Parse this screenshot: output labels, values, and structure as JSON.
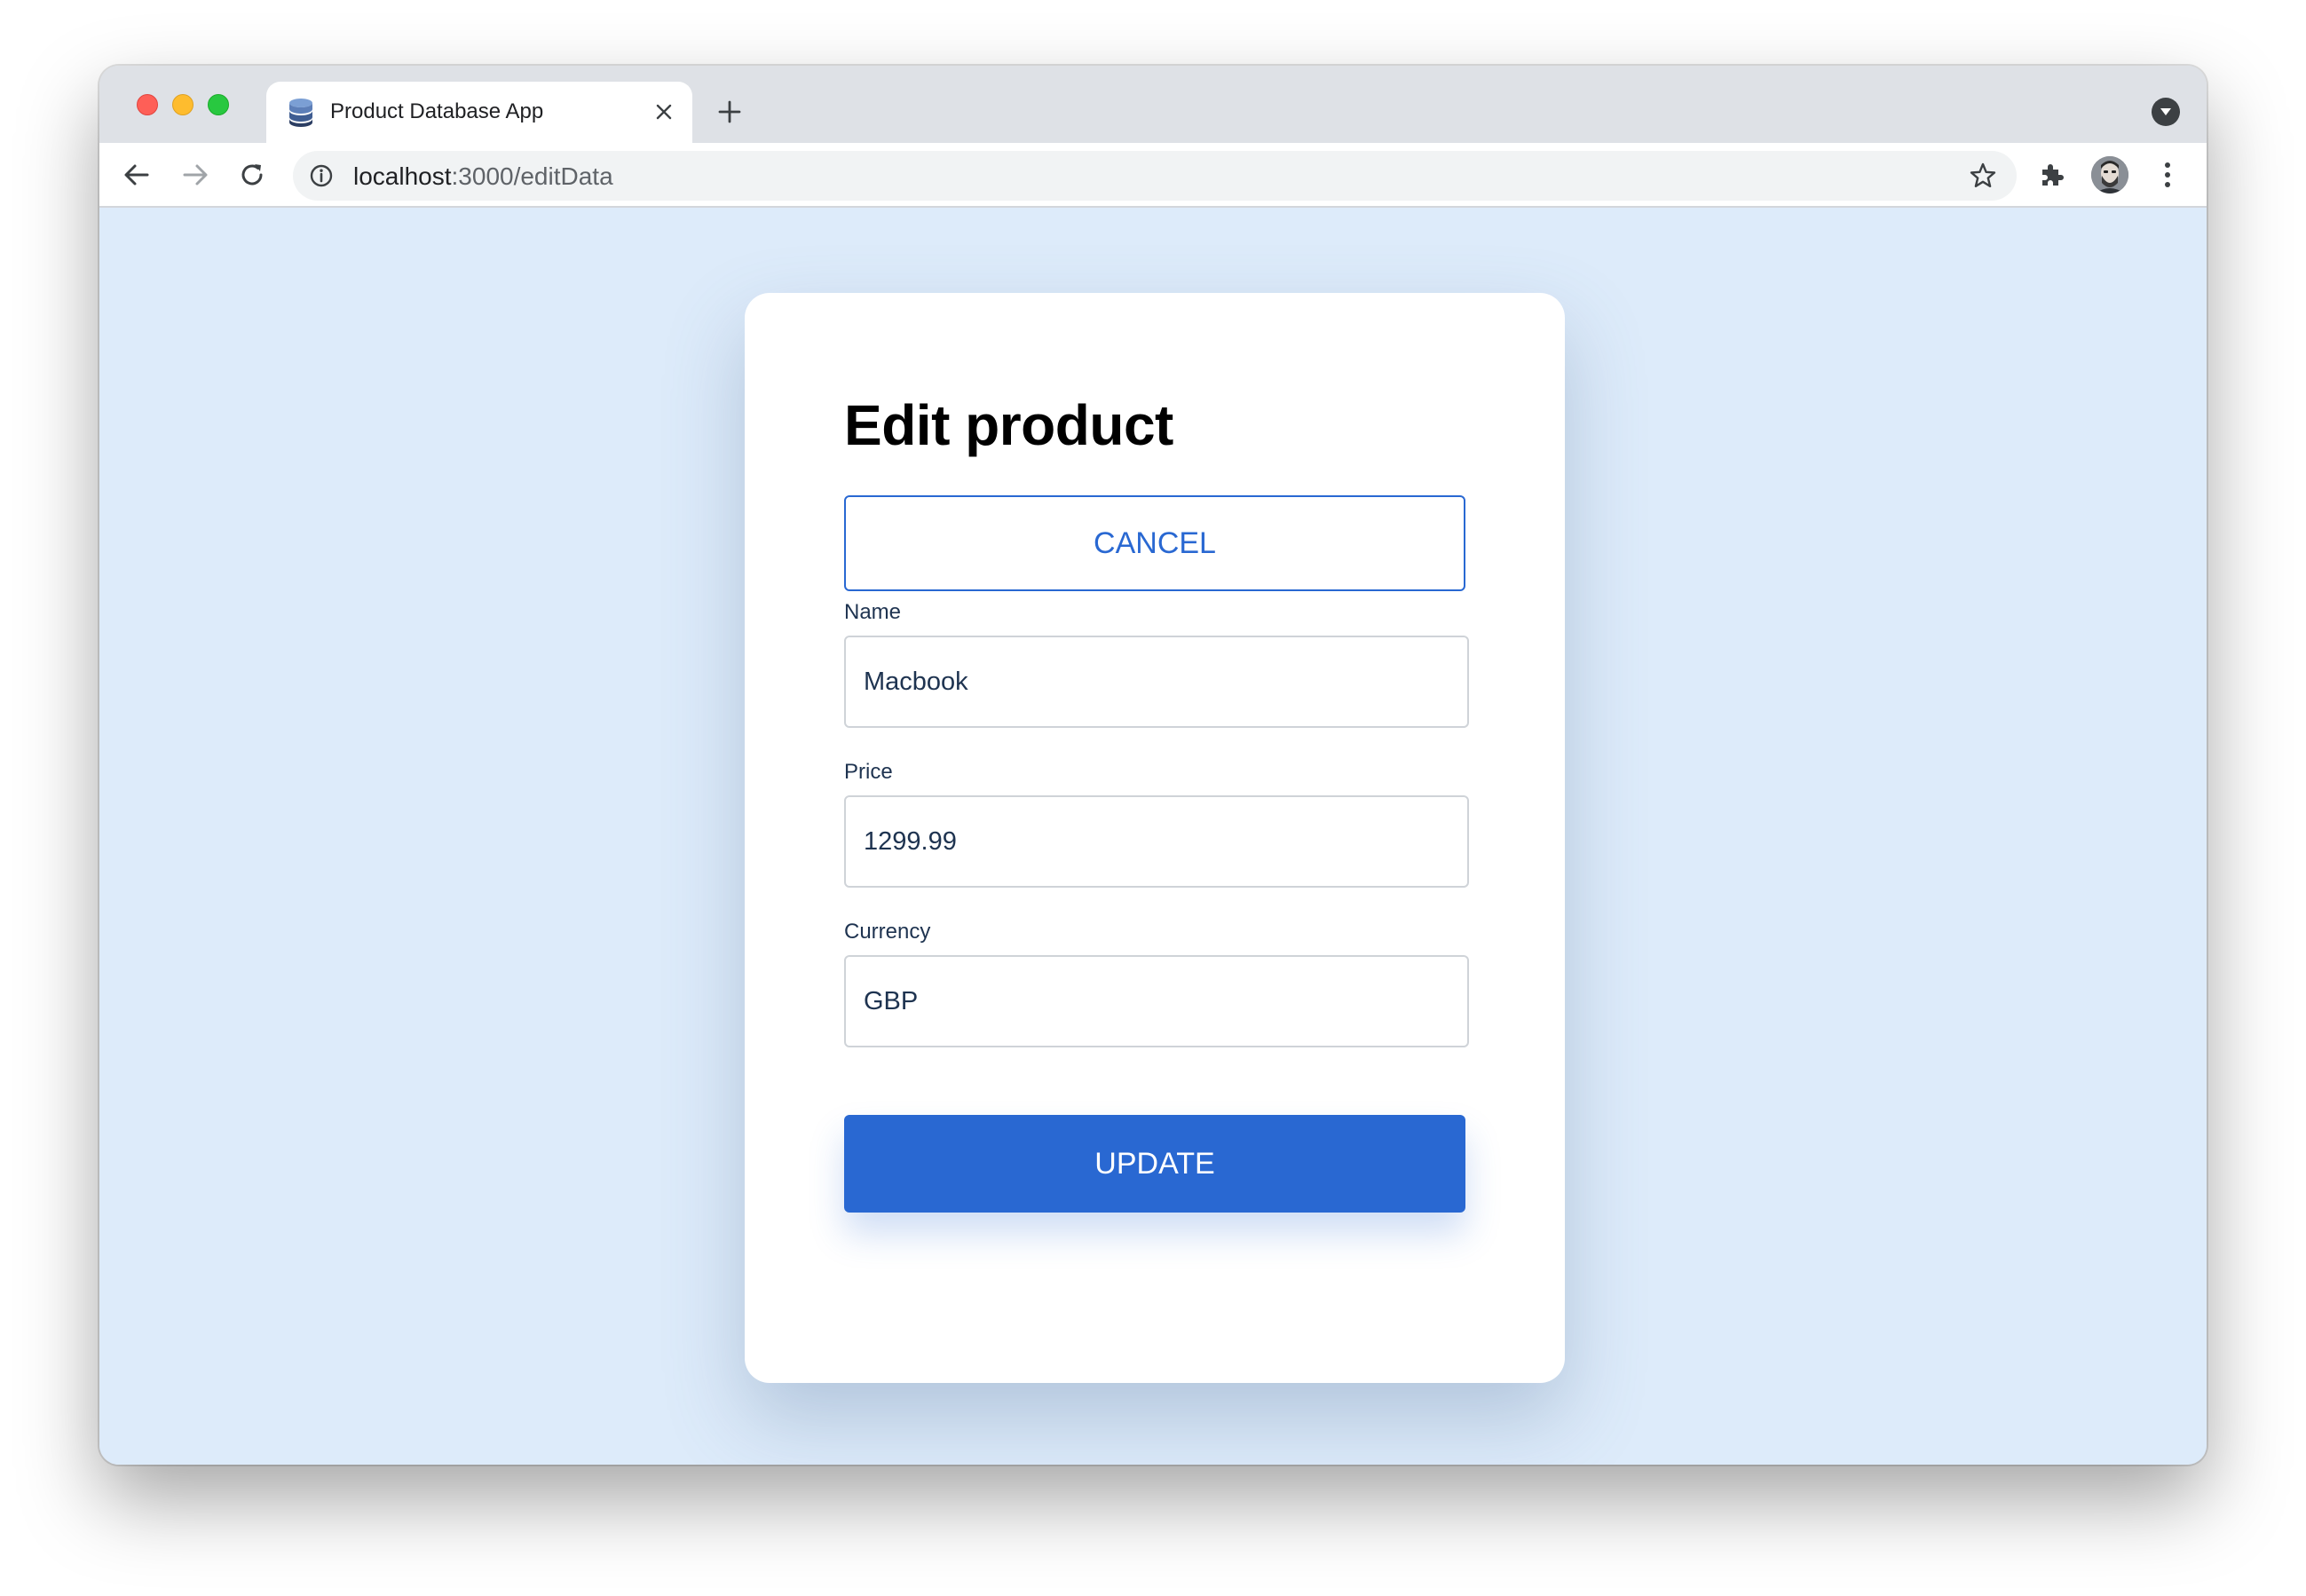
{
  "browser": {
    "tab": {
      "title": "Product Database App",
      "favicon": "database-icon"
    },
    "address_bar": {
      "host": "localhost",
      "path": ":3000/editData"
    },
    "icons": {
      "back": "arrow-left-icon",
      "forward": "arrow-right-icon",
      "reload": "reload-icon",
      "info": "info-icon",
      "bookmark": "star-icon",
      "extensions": "puzzle-icon",
      "menu": "kebab-menu-icon",
      "new_tab": "plus-icon",
      "tab_search": "chevron-down-icon"
    }
  },
  "form": {
    "title": "Edit product",
    "cancel_label": "CANCEL",
    "update_label": "UPDATE",
    "fields": {
      "name": {
        "label": "Name",
        "value": "Macbook"
      },
      "price": {
        "label": "Price",
        "value": "1299.99"
      },
      "currency": {
        "label": "Currency",
        "value": "GBP"
      }
    }
  },
  "colors": {
    "page_background": "#ddebfa",
    "accent": "#2968d2",
    "label_text": "#1e3350"
  }
}
